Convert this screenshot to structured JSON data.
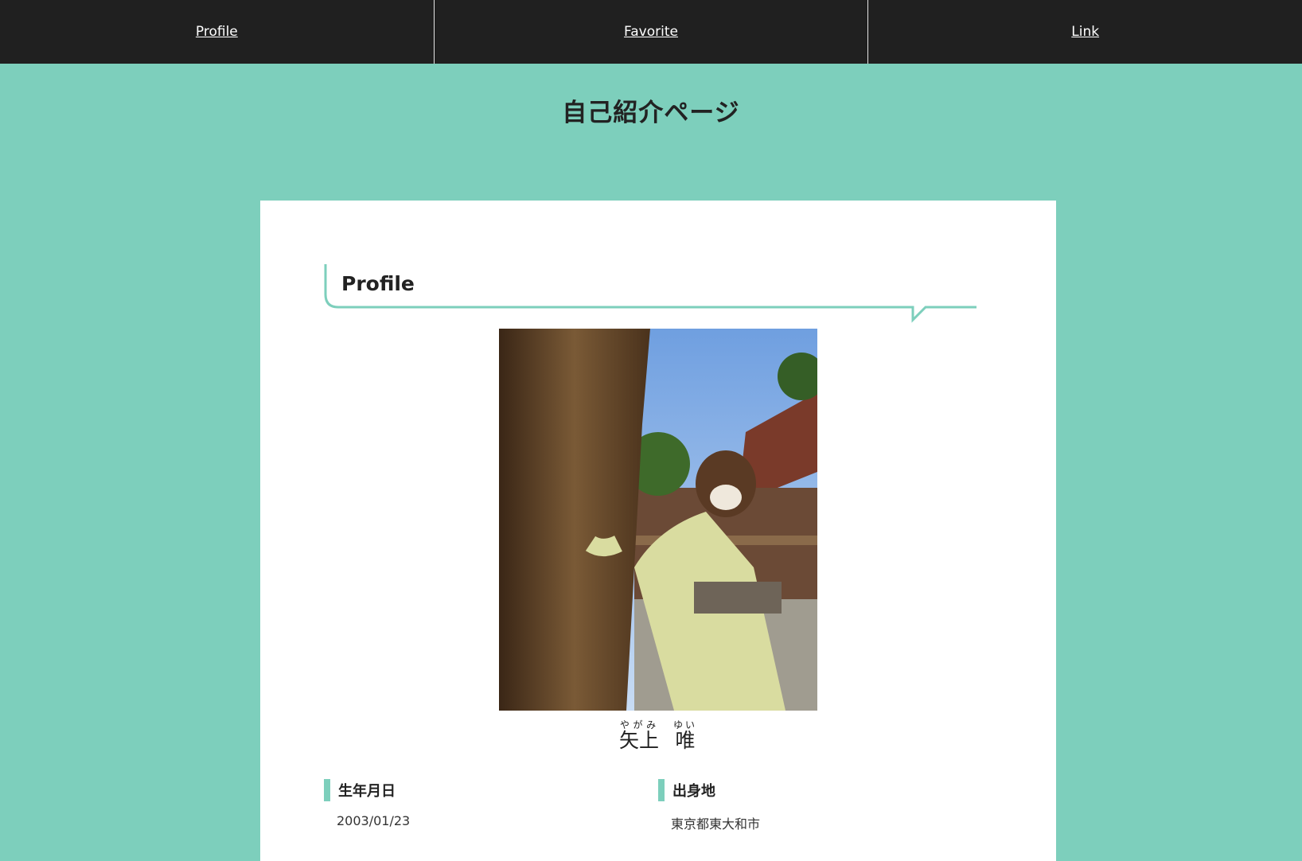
{
  "nav": {
    "items": [
      {
        "label": "Profile"
      },
      {
        "label": "Favorite"
      },
      {
        "label": "Link"
      }
    ]
  },
  "header": {
    "title": "自己紹介ページ"
  },
  "profile": {
    "section_title": "Profile",
    "photo_icon": "portrait-photo",
    "name": {
      "family": "矢上",
      "family_reading": "やがみ",
      "given": "唯",
      "given_reading": "ゆい"
    },
    "fields": [
      {
        "label": "生年月日",
        "value": "2003/01/23"
      },
      {
        "label": "出身地",
        "value": "東京都東大和市"
      }
    ]
  },
  "colors": {
    "background": "#7dcfbc",
    "nav": "#202020",
    "accent": "#7dcfbc"
  }
}
